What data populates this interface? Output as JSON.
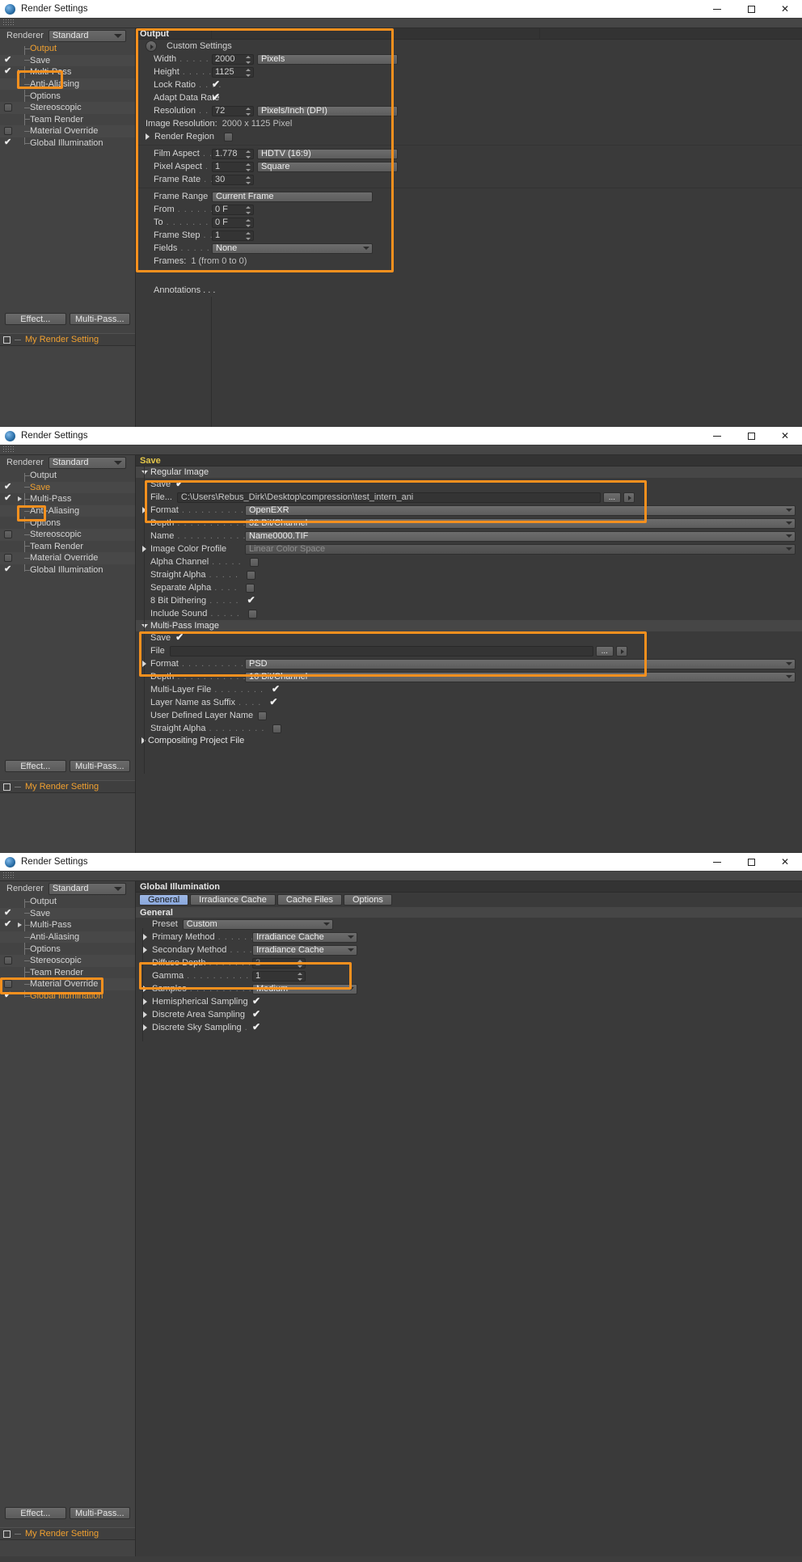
{
  "window": {
    "title": "Render Settings",
    "minimize_label": "–",
    "maximize_label": "□",
    "close_label": "✕"
  },
  "sidebar": {
    "renderer_label": "Renderer",
    "renderer_value": "Standard",
    "items": [
      {
        "label": "Output",
        "checkbox": "none",
        "expand": false,
        "selected": true
      },
      {
        "label": "Save",
        "checkbox": "checked",
        "expand": false,
        "selected": false
      },
      {
        "label": "Multi-Pass",
        "checkbox": "checked",
        "expand": true,
        "selected": false
      },
      {
        "label": "Anti-Aliasing",
        "checkbox": "none",
        "expand": false,
        "selected": false
      },
      {
        "label": "Options",
        "checkbox": "none",
        "expand": false,
        "selected": false
      },
      {
        "label": "Stereoscopic",
        "checkbox": "unchecked",
        "expand": false,
        "selected": false
      },
      {
        "label": "Team Render",
        "checkbox": "none",
        "expand": false,
        "selected": false
      },
      {
        "label": "Material Override",
        "checkbox": "unchecked",
        "expand": false,
        "selected": false
      },
      {
        "label": "Global Illumination",
        "checkbox": "checked",
        "expand": false,
        "selected": false
      }
    ],
    "effect_button": "Effect...",
    "multipass_button": "Multi-Pass...",
    "render_setting_name": "My Render Setting"
  },
  "output_panel": {
    "title": "Output",
    "custom_settings_label": "Custom Settings",
    "rows": [
      {
        "label": "Width",
        "dots": ". . . . . . . .",
        "value": "2000",
        "unit": "Pixels",
        "type": "num-unit"
      },
      {
        "label": "Height",
        "dots": ". . . . . . . .",
        "value": "1125",
        "unit": "",
        "type": "num"
      },
      {
        "label": "Lock Ratio",
        "dots": ". . . .",
        "value": "checked",
        "unit": "",
        "type": "check"
      },
      {
        "label": "Adapt Data Rate",
        "dots": "",
        "value": "checked",
        "unit": "",
        "type": "check"
      },
      {
        "label": "Resolution",
        "dots": ". . . .",
        "value": "72",
        "unit": "Pixels/Inch (DPI)",
        "type": "num-unit"
      }
    ],
    "image_resolution_label": "Image Resolution:",
    "image_resolution_value": "2000 x 1125 Pixel",
    "render_region_label": "Render Region",
    "render_region_value": "unchecked",
    "aspect_rows": [
      {
        "label": "Film Aspect",
        "dots": ". . .",
        "value": "1.778",
        "unit": "HDTV (16:9)"
      },
      {
        "label": "Pixel Aspect",
        "dots": ". . .",
        "value": "1",
        "unit": "Square"
      },
      {
        "label": "Frame Rate",
        "dots": ". . . .",
        "value": "30",
        "unit": ""
      }
    ],
    "frame_range_label": "Frame Range",
    "frame_range_dots": ". .",
    "frame_range_value": "Current Frame",
    "frame_rows": [
      {
        "label": "From",
        "dots": ". . . . . . . .",
        "value": "0 F"
      },
      {
        "label": "To",
        "dots": ". . . . . . . . . .",
        "value": "0 F"
      },
      {
        "label": "Frame Step",
        "dots": ". . . .",
        "value": "1"
      }
    ],
    "fields_label": "Fields",
    "fields_dots": ". . . . . . . .",
    "fields_value": "None",
    "frames_label": "Frames:",
    "frames_value": "1 (from 0 to 0)",
    "annotations_label": "Annotations . . ."
  },
  "save_panel": {
    "title": "Save",
    "regular_image_group": "Regular Image",
    "regular": [
      {
        "label": "Save",
        "dots": "",
        "value": "checked",
        "type": "check"
      },
      {
        "label": "File...",
        "dots": "",
        "value": "C:\\Users\\Rebus_Dirk\\Desktop\\compression\\test_intern_ani",
        "type": "path"
      },
      {
        "label": "Format",
        "dots": ". . . . . . . . . .",
        "value": "OpenEXR",
        "type": "select",
        "expand": true
      },
      {
        "label": "Depth",
        "dots": ". . . . . . . . . . .",
        "value": "32 Bit/Channel",
        "type": "select"
      },
      {
        "label": "Name",
        "dots": ". . . . . . . . . . . .",
        "value": "Name0000.TIF",
        "type": "select"
      },
      {
        "label": "Image Color Profile",
        "dots": "",
        "value": "Linear Color Space",
        "type": "select-dim",
        "expand": true
      },
      {
        "label": "Alpha Channel",
        "dots": ". . . . .",
        "value": "unchecked",
        "type": "check"
      },
      {
        "label": "Straight Alpha",
        "dots": ". . . . .",
        "value": "unchecked",
        "type": "check-dim"
      },
      {
        "label": "Separate Alpha",
        "dots": ". . . .",
        "value": "unchecked",
        "type": "check-dim"
      },
      {
        "label": "8 Bit Dithering",
        "dots": ". . . . .",
        "value": "checked",
        "type": "check"
      },
      {
        "label": "Include Sound",
        "dots": ". . . . .",
        "value": "unchecked",
        "type": "check-dim"
      }
    ],
    "multipass_group": "Multi-Pass Image",
    "multipass": [
      {
        "label": "Save",
        "dots": "",
        "value": "checked",
        "type": "check"
      },
      {
        "label": "File",
        "dots": "",
        "value": "",
        "type": "path"
      },
      {
        "label": "Format",
        "dots": ". . . . . . . . . . . .",
        "value": "PSD",
        "type": "select",
        "expand": true
      },
      {
        "label": "Depth",
        "dots": ". . . . . . . . . . . .",
        "value": "16 Bit/Channel",
        "type": "select"
      },
      {
        "label": "Multi-Layer File",
        "dots": ". . . . . . . .",
        "value": "checked",
        "type": "check"
      },
      {
        "label": "Layer Name as Suffix",
        "dots": ". . . .",
        "value": "checked",
        "type": "check"
      },
      {
        "label": "User Defined Layer Name",
        "dots": "",
        "value": "unchecked",
        "type": "check"
      },
      {
        "label": "Straight Alpha",
        "dots": ". . . . . . . . .",
        "value": "unchecked",
        "type": "check-dim"
      }
    ],
    "compositing_group": "Compositing Project File",
    "browse_label": "..."
  },
  "gi_panel": {
    "title": "Global Illumination",
    "tabs": [
      {
        "label": "General",
        "active": true
      },
      {
        "label": "Irradiance Cache",
        "active": false
      },
      {
        "label": "Cache Files",
        "active": false
      },
      {
        "label": "Options",
        "active": false
      }
    ],
    "section_label": "General",
    "preset_label": "Preset",
    "preset_value": "Custom",
    "rows": [
      {
        "label": "Primary Method",
        "dots": ". . . . . . .",
        "value": "Irradiance Cache",
        "type": "select",
        "expand": true
      },
      {
        "label": "Secondary Method",
        "dots": ". . . .",
        "value": "Irradiance Cache",
        "type": "select",
        "expand": true
      },
      {
        "label": "Diffuse Depth",
        "dots": ". . . . . . . . .",
        "value": "2",
        "type": "num-dim",
        "expand": false
      },
      {
        "label": "Gamma",
        "dots": ". . . . . . . . . . . .",
        "value": "1",
        "type": "num",
        "expand": false
      },
      {
        "label": "Samples",
        "dots": ". . . . . . . . . . . .",
        "value": "Medium",
        "type": "select",
        "expand": true
      },
      {
        "label": "Hemispherical Sampling",
        "dots": "",
        "value": "checked",
        "type": "check",
        "expand": true
      },
      {
        "label": "Discrete Area Sampling",
        "dots": "",
        "value": "checked",
        "type": "check",
        "expand": true
      },
      {
        "label": "Discrete Sky Sampling",
        "dots": ".",
        "value": "checked",
        "type": "check",
        "expand": true
      }
    ]
  },
  "colors": {
    "highlight": "#f6901e",
    "panel_title": "#e4c74a",
    "selected_item": "#f0a030",
    "tab_active": "#9db7e4"
  }
}
